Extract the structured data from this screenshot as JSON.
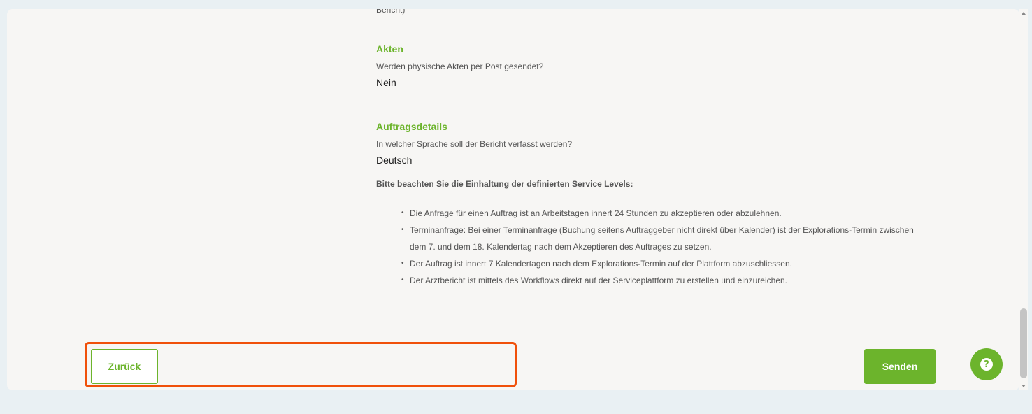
{
  "content": {
    "cut_text": "Bericht)",
    "akten": {
      "title": "Akten",
      "question": "Werden physische Akten per Post gesendet?",
      "answer": "Nein"
    },
    "auftragsdetails": {
      "title": "Auftragsdetails",
      "question": "In welcher Sprache soll der Bericht verfasst werden?",
      "answer": "Deutsch"
    },
    "service_note": "Bitte beachten Sie die Einhaltung der definierten Service Levels:",
    "service_levels": [
      "Die Anfrage für einen Auftrag ist an Arbeitstagen innert 24 Stunden zu akzeptieren oder abzulehnen.",
      "Terminanfrage: Bei einer Terminanfrage (Buchung seitens Auftraggeber nicht direkt über Kalender) ist der Explorations-Termin zwischen dem 7. und dem 18. Kalendertag nach dem Akzeptieren des Auftrages zu setzen.",
      "Der Auftrag ist innert 7 Kalendertagen nach dem Explorations-Termin auf der Plattform abzuschliessen.",
      "Der Arztbericht ist mittels des Workflows direkt auf der Serviceplattform zu erstellen und einzureichen."
    ]
  },
  "buttons": {
    "back_label": "Zurück",
    "send_label": "Senden"
  },
  "help": {
    "glyph": "?"
  },
  "colors": {
    "accent": "#6cb42c",
    "highlight": "#f0500a"
  }
}
